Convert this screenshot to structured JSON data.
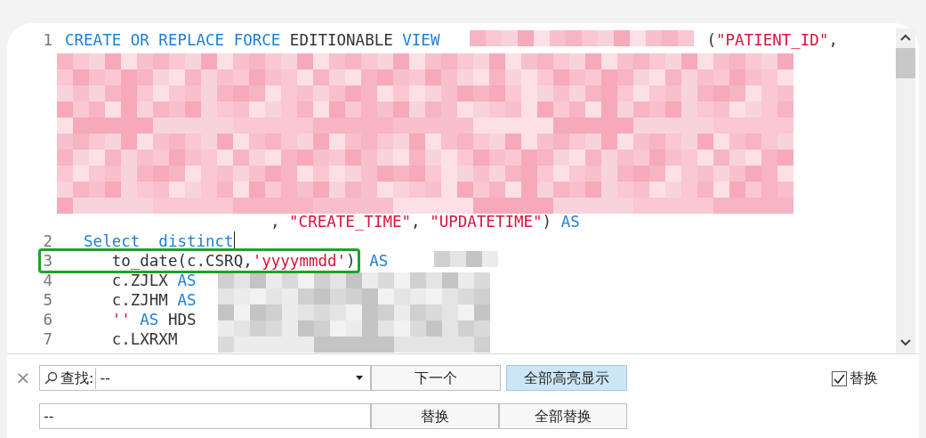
{
  "editor": {
    "rows": [
      {
        "number": "1",
        "segments": [
          {
            "kind": "keyword",
            "text": "CREATE OR REPLACE FORCE"
          },
          {
            "kind": "plain",
            "text": " EDITIONABLE "
          },
          {
            "kind": "keyword",
            "text": "VIEW"
          }
        ],
        "tail": [
          {
            "kind": "plain",
            "text": "("
          },
          {
            "kind": "string",
            "text": "\"PATIENT_ID\""
          },
          {
            "kind": "plain",
            "text": ","
          }
        ]
      },
      {
        "continuation": true,
        "segments": [
          {
            "kind": "plain",
            "text": ", "
          },
          {
            "kind": "string",
            "text": "\"CREATE_TIME\""
          },
          {
            "kind": "plain",
            "text": ", "
          },
          {
            "kind": "string",
            "text": "\"UPDATETIME\""
          },
          {
            "kind": "plain",
            "text": ") "
          },
          {
            "kind": "keyword",
            "text": "AS"
          }
        ]
      },
      {
        "number": "2",
        "cursor": true,
        "segments": [
          {
            "kind": "keyword",
            "text": "  Select  distinct"
          }
        ]
      },
      {
        "number": "3",
        "highlight": true,
        "segments": [
          {
            "kind": "plain",
            "text": "     to_date(c.CSRQ,"
          },
          {
            "kind": "string",
            "text": "'yyyymmdd'"
          },
          {
            "kind": "plain",
            "text": ")"
          }
        ],
        "after": [
          {
            "kind": "keyword",
            "text": " AS"
          }
        ]
      },
      {
        "number": "4",
        "segments": [
          {
            "kind": "plain",
            "text": "     c.ZJLX "
          },
          {
            "kind": "keyword",
            "text": "AS"
          }
        ]
      },
      {
        "number": "5",
        "segments": [
          {
            "kind": "plain",
            "text": "     c.ZJHM "
          },
          {
            "kind": "keyword",
            "text": "AS"
          }
        ]
      },
      {
        "number": "6",
        "segments": [
          {
            "kind": "string",
            "text": "     ''"
          },
          {
            "kind": "keyword",
            "text": " AS"
          },
          {
            "kind": "plain",
            "text": " HDS"
          }
        ]
      },
      {
        "number": "7",
        "segments": [
          {
            "kind": "plain",
            "text": "     c.LXRXM"
          }
        ]
      }
    ]
  },
  "find_bar": {
    "close": "×",
    "find_label": "查找:",
    "find_value": "--",
    "next_button": "下一个",
    "highlight_all": {
      "label": "全部高亮显示",
      "on": true
    },
    "replace_toggle": {
      "label": "替换",
      "checked": true
    },
    "replace_value": "--",
    "replace_button": "替换",
    "replace_all_button": "全部替换"
  }
}
